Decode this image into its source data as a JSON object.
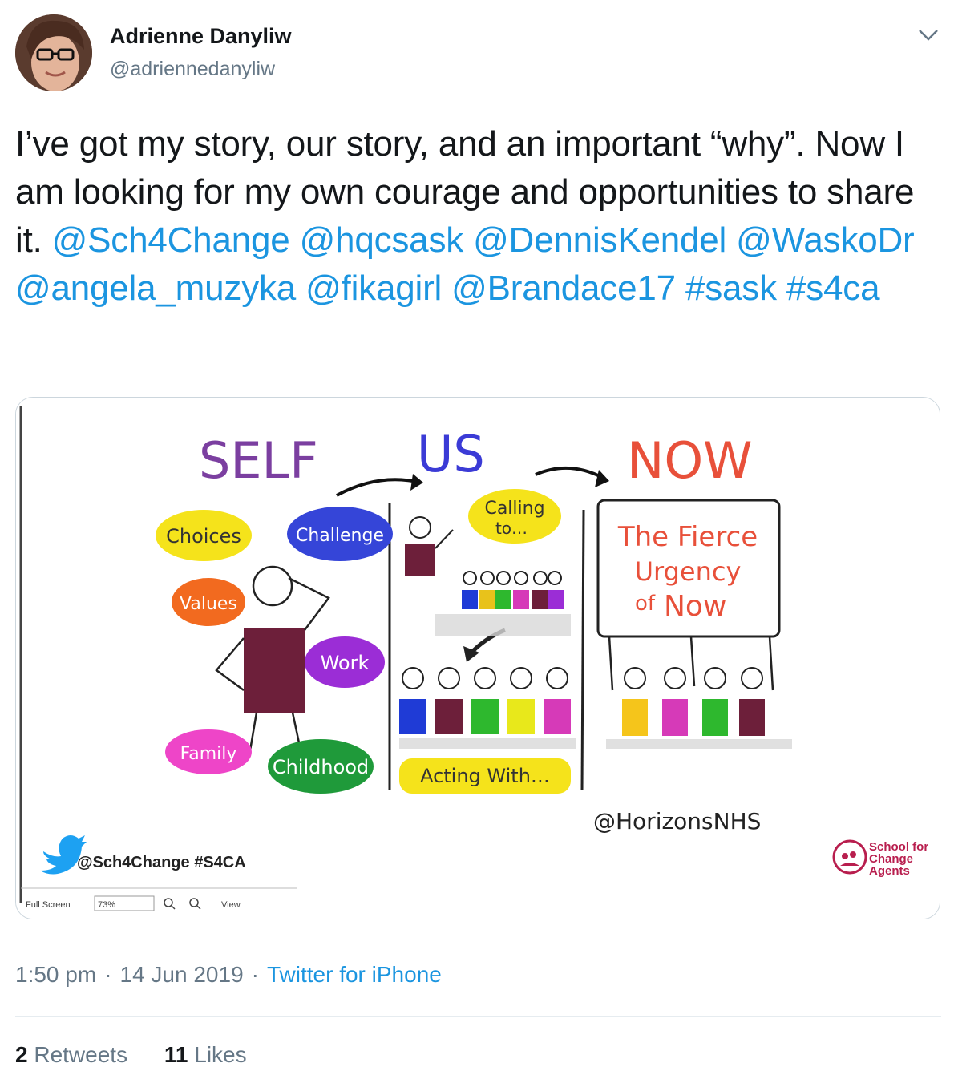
{
  "author": {
    "name": "Adrienne Danyliw",
    "handle": "@adriennedanyliw"
  },
  "tweet": {
    "text_plain": "I’ve got my story, our story, and an important “why”. Now I am looking for my own courage and opportunities to share it.",
    "mentions": [
      "@Sch4Change",
      "@hqcsask",
      "@DennisKendel",
      "@WaskoDr",
      "@angela_muzyka",
      "@fikagirl",
      "@Brandace17"
    ],
    "hashtags": [
      "#sask",
      "#s4ca"
    ]
  },
  "image": {
    "headings": {
      "self": "SELF",
      "us": "US",
      "now": "NOW"
    },
    "self_bubbles": [
      "Choices",
      "Challenge",
      "Values",
      "Work",
      "Family",
      "Childhood"
    ],
    "us_labels": {
      "calling_line1": "Calling",
      "calling_line2": "to…",
      "acting": "Acting With…"
    },
    "now_sign": {
      "line1": "The Fierce",
      "line2": "Urgency",
      "line3_of": "of",
      "line3_now": "Now"
    },
    "credit": "@HorizonsNHS",
    "footer_left": "@Sch4Change #S4CA",
    "footer_right": {
      "line1": "School for",
      "line2": "Change",
      "line3": "Agents"
    },
    "toolbar": {
      "full_screen": "Full Screen",
      "zoom": "73%",
      "view": "View"
    }
  },
  "meta": {
    "time": "1:50 pm",
    "date": "14 Jun 2019",
    "source": "Twitter for iPhone"
  },
  "stats": {
    "retweets_count": "2",
    "retweets_label": "Retweets",
    "likes_count": "11",
    "likes_label": "Likes"
  },
  "colors": {
    "link": "#1b95e0",
    "secondary": "#657786",
    "primary_text": "#14171a",
    "self_purple": "#7b3fa0",
    "us_blue": "#3b3bd6",
    "now_red": "#e8503a"
  }
}
